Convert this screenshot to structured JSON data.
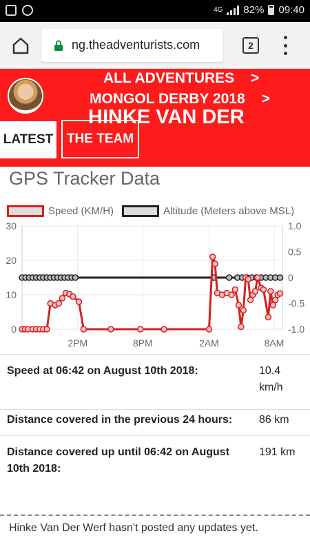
{
  "status_bar": {
    "network": "4G",
    "battery": "82%",
    "time": "09:40"
  },
  "browser": {
    "url": "ng.theadventurists.com",
    "tab_count": "2",
    "icons": [
      "home-icon",
      "lock-icon",
      "tabs-icon",
      "menu-icon"
    ]
  },
  "header": {
    "crumb_all": "ALL ADVENTURES",
    "crumb_event": "MONGOL DERBY 2018",
    "crumb_sep": ">",
    "participant_name": "HINKE VAN DER",
    "tabs": [
      {
        "label": "LATEST",
        "active": true
      },
      {
        "label": "THE TEAM",
        "active": false
      }
    ],
    "accent_color": "#fe1b1b"
  },
  "gps": {
    "title": "GPS Tracker Data",
    "legend": {
      "speed": "Speed (KM/H)",
      "altitude": "Altitude (Meters above MSL)"
    }
  },
  "chart_data": {
    "type": "line",
    "x_ticks": [
      "2PM",
      "8PM",
      "2AM",
      "8AM"
    ],
    "x": [
      0,
      0.5,
      1,
      1.5,
      2,
      2.5,
      3,
      3.5,
      4,
      4.5,
      5,
      5.5,
      6,
      6.5,
      7,
      7.5,
      8,
      8.5,
      9,
      9.5,
      10,
      10.5,
      11,
      11.5,
      12,
      12.5,
      13,
      13.5,
      14,
      14.5,
      15,
      15.5,
      16,
      16.5,
      17,
      17.5,
      18,
      18.5,
      19,
      19.5,
      20,
      20.5,
      21,
      21.5,
      22
    ],
    "y_left": {
      "ticks": [
        0,
        10,
        20,
        30
      ],
      "range": [
        0,
        30
      ]
    },
    "y_right": {
      "ticks": [
        "1.0",
        "0.5",
        "0",
        "-0.5",
        "-1.0"
      ],
      "range": [
        -1,
        1
      ]
    },
    "series": [
      {
        "name": "Speed (KM/H)",
        "color": "#d62020",
        "axis": "left",
        "points": [
          [
            0,
            0
          ],
          [
            0.25,
            0
          ],
          [
            0.5,
            0
          ],
          [
            0.9,
            0
          ],
          [
            1.2,
            0
          ],
          [
            1.5,
            0
          ],
          [
            1.8,
            0
          ],
          [
            2.1,
            0
          ],
          [
            2.4,
            7.5
          ],
          [
            2.8,
            7
          ],
          [
            3.1,
            7.5
          ],
          [
            3.4,
            9
          ],
          [
            3.7,
            10.5
          ],
          [
            4.0,
            10.2
          ],
          [
            4.3,
            9.5
          ],
          [
            4.8,
            8
          ],
          [
            5.2,
            0
          ],
          [
            7.5,
            0
          ],
          [
            10,
            0
          ],
          [
            12,
            0
          ],
          [
            15.8,
            0
          ],
          [
            16.1,
            21
          ],
          [
            16.3,
            19
          ],
          [
            16.5,
            10.5
          ],
          [
            16.9,
            10
          ],
          [
            17.3,
            10.5
          ],
          [
            17.7,
            10
          ],
          [
            18.0,
            11.5
          ],
          [
            18.3,
            7
          ],
          [
            18.5,
            0.7
          ],
          [
            18.7,
            5.5
          ],
          [
            18.9,
            15
          ],
          [
            19.1,
            14.5
          ],
          [
            19.3,
            8.5
          ],
          [
            19.5,
            10
          ],
          [
            19.7,
            11
          ],
          [
            19.9,
            15
          ],
          [
            20.2,
            12
          ],
          [
            20.4,
            11.5
          ],
          [
            20.8,
            3.5
          ],
          [
            21.0,
            11
          ],
          [
            21.2,
            7
          ],
          [
            21.4,
            8.5
          ],
          [
            21.6,
            10
          ],
          [
            21.8,
            10.4
          ]
        ]
      },
      {
        "name": "Altitude (Meters above MSL)",
        "color": "#222222",
        "axis": "right",
        "value": 0,
        "x_from": 0,
        "x_to": 22
      }
    ]
  },
  "stats": {
    "speed_label": "Speed at 06:42 on August 10th 2018:",
    "speed_value": "10.4 km/h",
    "distance24_label": "Distance covered in the previous 24 hours:",
    "distance24_value": "86 km",
    "distance_total_label": "Distance covered up until 06:42 on August 10th 2018:",
    "distance_total_value": "191 km"
  },
  "footer": {
    "no_updates": "Hinke Van Der Werf hasn't posted any updates yet."
  }
}
